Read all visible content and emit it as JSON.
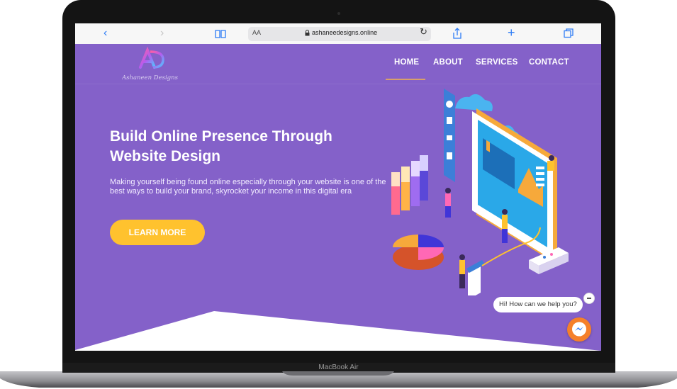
{
  "device": {
    "label": "MacBook Air"
  },
  "browser": {
    "url": "ashaneedesigns.online",
    "text_size_label": "AA",
    "icons": [
      "back-icon",
      "forward-icon",
      "book-icon",
      "lock-icon",
      "reload-icon",
      "share-icon",
      "plus-icon",
      "tabs-icon"
    ]
  },
  "site": {
    "logo_text": "Ashaneen Designs",
    "nav": [
      "HOME",
      "ABOUT",
      "SERVICES",
      "CONTACT"
    ],
    "active_nav": "HOME",
    "hero_title": "Build Online Presence Through Website Design",
    "hero_subtitle": "Making yourself being found online especially through your website is one of the best ways to build your brand, skyrocket your income in this digital era",
    "cta_label": "LEARN MORE",
    "chat_prompt": "Hi! How can we help you?"
  },
  "colors": {
    "hero_bg": "#8461c9",
    "cta": "#ffc22e",
    "messenger": "#f5802a",
    "nav_underline": "#d8a06a"
  }
}
